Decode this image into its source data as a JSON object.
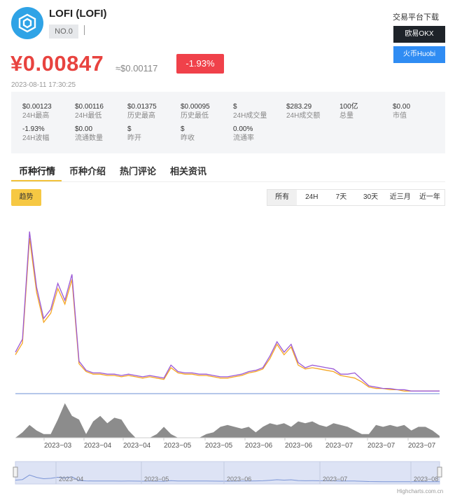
{
  "coin": {
    "title": "LOFI (LOFI)",
    "rank": "NO.0",
    "logo_icon": "cube-logo-icon"
  },
  "exchanges": {
    "title": "交易平台下载",
    "okx": "欧易OKX",
    "huobi": "火币Huobi"
  },
  "price": {
    "cny": "¥0.00847",
    "usd": "≈$0.00117",
    "change": "-1.93%",
    "timestamp": "2023-08-11 17:30:25"
  },
  "stats": [
    {
      "value": "$0.00123",
      "label": "24H最高"
    },
    {
      "value": "$0.00116",
      "label": "24H最低"
    },
    {
      "value": "$0.01375",
      "label": "历史最高"
    },
    {
      "value": "$0.00095",
      "label": "历史最低"
    },
    {
      "value": "$",
      "label": "24H成交量"
    },
    {
      "value": "$283.29",
      "label": "24H成交额"
    },
    {
      "value": "100亿",
      "label": "总量"
    },
    {
      "value": "$0.00",
      "label": "市值"
    },
    {
      "value": "-1.93%",
      "label": "24H波幅"
    },
    {
      "value": "$0.00",
      "label": "流通数量"
    },
    {
      "value": "$",
      "label": "昨开"
    },
    {
      "value": "$",
      "label": "昨收"
    },
    {
      "value": "0.00%",
      "label": "流通率"
    }
  ],
  "tabs": [
    "币种行情",
    "币种介绍",
    "热门评论",
    "相关资讯"
  ],
  "chart_controls": {
    "trend": "趋势",
    "ranges": [
      "所有",
      "24H",
      "7天",
      "30天",
      "近三月",
      "近一年"
    ],
    "active_range": 0
  },
  "chart_data": {
    "type": "line",
    "x_ticks": [
      "2023−03",
      "2023−04",
      "2023−04",
      "2023−05",
      "2023−05",
      "2023−06",
      "2023−06",
      "2023−07",
      "2023−07",
      "2023−07"
    ],
    "navigator_ticks": [
      "2023−04",
      "2023−05",
      "2023−06",
      "2023−07",
      "2023−08"
    ],
    "series": [
      {
        "color": "#9b59d6",
        "values": [
          0.0032,
          0.0042,
          0.0125,
          0.0082,
          0.0058,
          0.0065,
          0.0085,
          0.0072,
          0.0092,
          0.0025,
          0.0018,
          0.0016,
          0.0016,
          0.0015,
          0.0015,
          0.0014,
          0.0015,
          0.0014,
          0.0013,
          0.0014,
          0.0013,
          0.0012,
          0.0022,
          0.0017,
          0.0016,
          0.0016,
          0.0015,
          0.0015,
          0.0014,
          0.0013,
          0.0013,
          0.0014,
          0.0015,
          0.0017,
          0.0018,
          0.002,
          0.0029,
          0.004,
          0.0032,
          0.0038,
          0.0024,
          0.002,
          0.0022,
          0.0021,
          0.002,
          0.0019,
          0.0015,
          0.0015,
          0.0016,
          0.0011,
          0.0006,
          0.0005,
          0.0004,
          0.0004,
          0.0003,
          0.0003,
          0.0002,
          0.0002,
          0.0002,
          0.0002,
          0.0002
        ]
      },
      {
        "color": "#f5a623",
        "values": [
          0.003,
          0.0039,
          0.012,
          0.0078,
          0.0055,
          0.0062,
          0.0081,
          0.0069,
          0.0088,
          0.0023,
          0.0017,
          0.0015,
          0.0015,
          0.0014,
          0.0014,
          0.0013,
          0.0014,
          0.0013,
          0.0012,
          0.0013,
          0.0012,
          0.0011,
          0.002,
          0.0016,
          0.0015,
          0.0015,
          0.0014,
          0.0014,
          0.0013,
          0.0012,
          0.0012,
          0.0013,
          0.0014,
          0.0016,
          0.0017,
          0.0019,
          0.0027,
          0.0038,
          0.003,
          0.0036,
          0.0022,
          0.0019,
          0.002,
          0.0019,
          0.0018,
          0.0017,
          0.0014,
          0.0013,
          0.0012,
          0.0009,
          0.0005,
          0.0004,
          0.0004,
          0.0003,
          0.0003,
          0.0002,
          0.0002,
          0.0002,
          0.0002,
          0.0002,
          0.0002
        ]
      }
    ],
    "volume": [
      0,
      0.15,
      0.35,
      0.2,
      0.1,
      0.1,
      0.5,
      0.95,
      0.6,
      0.5,
      0.1,
      0.45,
      0.6,
      0.4,
      0.55,
      0.5,
      0.2,
      0,
      0,
      0,
      0.1,
      0.3,
      0.1,
      0,
      0,
      0,
      0,
      0.1,
      0.15,
      0.3,
      0.35,
      0.3,
      0.25,
      0.3,
      0.15,
      0.3,
      0.4,
      0.35,
      0.4,
      0.3,
      0.45,
      0.4,
      0.45,
      0.35,
      0.3,
      0.4,
      0.35,
      0.3,
      0.2,
      0.1,
      0.1,
      0.35,
      0.3,
      0.35,
      0.3,
      0.35,
      0.2,
      0.3,
      0.3,
      0.2,
      0.05
    ]
  },
  "credit": "Highcharts.com.cn"
}
